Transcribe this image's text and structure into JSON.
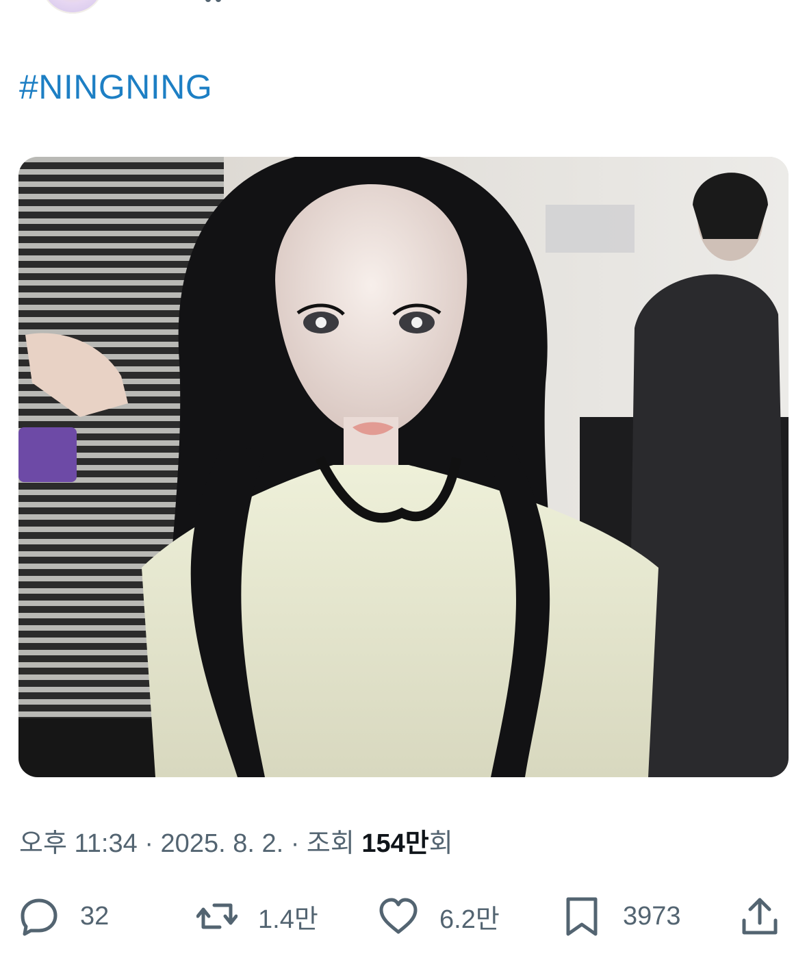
{
  "tweet": {
    "hashtag": "#NINGNING",
    "meta": {
      "time": "오후 11:34",
      "separator1": " · ",
      "date": "2025. 8. 2.",
      "separator2": " · ",
      "views_prefix": "조회 ",
      "views_count": "154만",
      "views_suffix": "회"
    },
    "actions": {
      "replies": "32",
      "reposts": "1.4만",
      "likes": "6.2만",
      "bookmarks": "3973"
    }
  },
  "icons": {
    "reply": "speech-bubble-icon",
    "repost": "repost-arrows-icon",
    "like": "heart-icon",
    "bookmark": "bookmark-icon",
    "share": "share-upload-icon"
  },
  "colors": {
    "hashtag": "#1d7fc4",
    "secondary_text": "#536471",
    "primary_text": "#0f1419"
  }
}
